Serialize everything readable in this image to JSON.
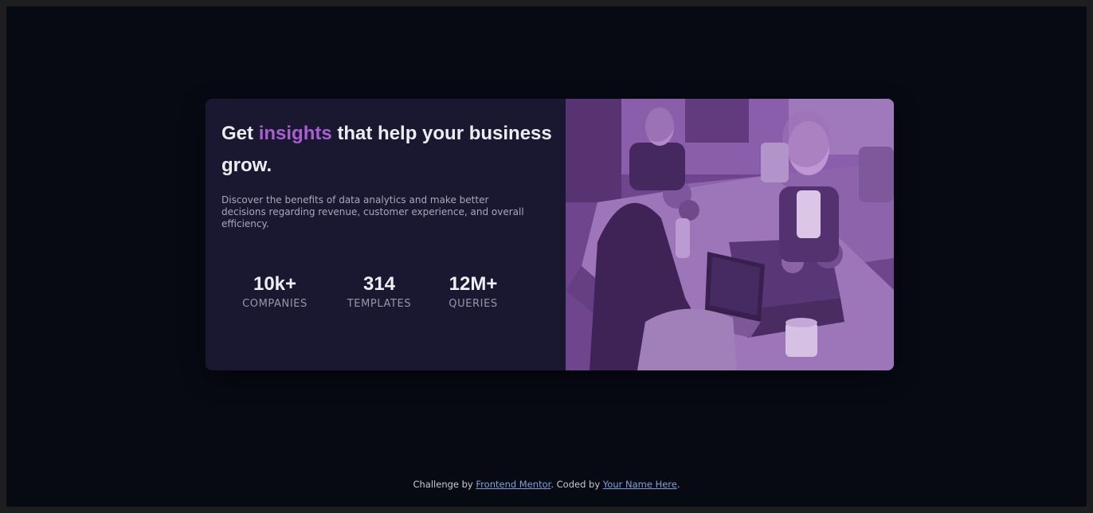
{
  "card": {
    "headline": {
      "before": "Get ",
      "accent": "insights",
      "after": " that help your business grow."
    },
    "description": "Discover the benefits of data analytics and make better decisions regarding revenue, customer experience, and overall efficiency.",
    "stats": [
      {
        "value": "10k+",
        "label": "COMPANIES"
      },
      {
        "value": "314",
        "label": "TEMPLATES"
      },
      {
        "value": "12M+",
        "label": "QUERIES"
      }
    ],
    "image_alt": "people working at laptops in an office"
  },
  "footer": {
    "prefix": "Challenge by ",
    "challenge_link": "Frontend Mentor",
    "middle": ". Coded by ",
    "author_link": "Your Name Here",
    "suffix": "."
  },
  "colors": {
    "page_background": "#070a13",
    "card_background": "#1a1730",
    "accent": "#a85fd1",
    "heading_text": "#ececf2",
    "body_text": "#a9a6bd",
    "link": "#7da2d6",
    "image_tint": "#6e4a8c"
  }
}
